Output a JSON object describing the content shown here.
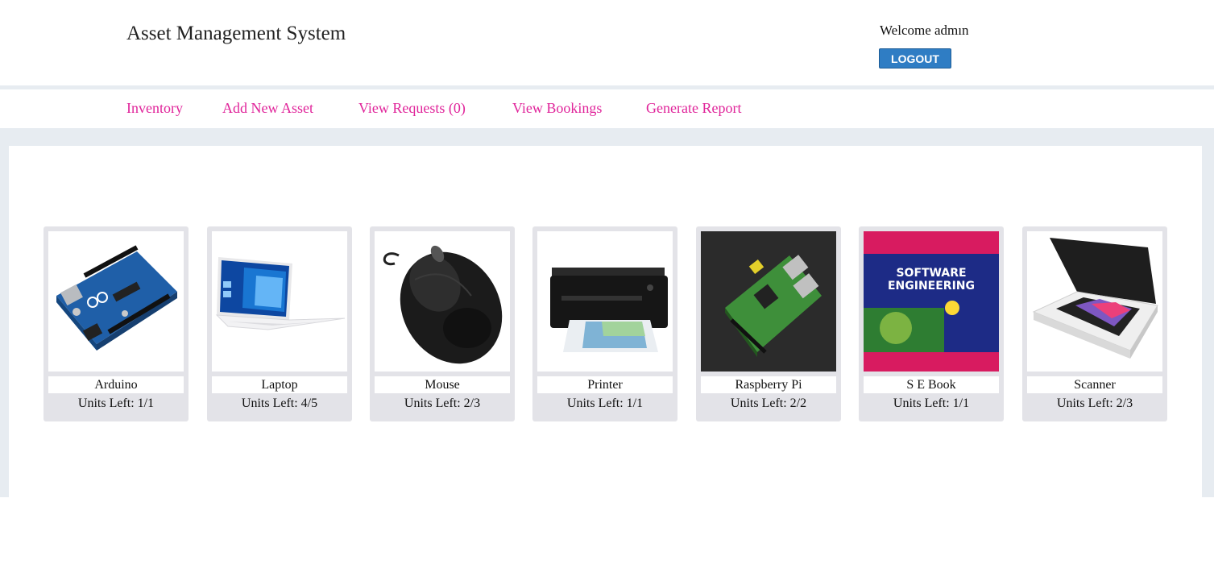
{
  "header": {
    "app_title": "Asset Management System",
    "welcome_text": "Welcome admın",
    "logout_label": "LOGOUT"
  },
  "nav": {
    "items": [
      {
        "label": "Inventory"
      },
      {
        "label": "Add New Asset"
      },
      {
        "label": "View Requests (0)"
      },
      {
        "label": "View Bookings"
      },
      {
        "label": "Generate Report"
      }
    ]
  },
  "assets": [
    {
      "name": "Arduino",
      "units": "Units Left: 1/1",
      "icon": "arduino-board-image"
    },
    {
      "name": "Laptop",
      "units": "Units Left: 4/5",
      "icon": "laptop-image"
    },
    {
      "name": "Mouse",
      "units": "Units Left: 2/3",
      "icon": "mouse-image"
    },
    {
      "name": "Printer",
      "units": "Units Left: 1/1",
      "icon": "printer-image"
    },
    {
      "name": "Raspberry Pi",
      "units": "Units Left: 2/2",
      "icon": "raspberry-pi-image"
    },
    {
      "name": "S E Book",
      "units": "Units Left: 1/1",
      "icon": "book-cover-image",
      "cover_title_line1": "SOFTWARE",
      "cover_title_line2": "ENGINEERING"
    },
    {
      "name": "Scanner",
      "units": "Units Left: 2/3",
      "icon": "scanner-image"
    }
  ],
  "colors": {
    "nav_link": "#e0249a",
    "logout_bg": "#2f7dc4",
    "page_bg": "#e7ecf1",
    "card_bg": "#e3e3e8"
  }
}
